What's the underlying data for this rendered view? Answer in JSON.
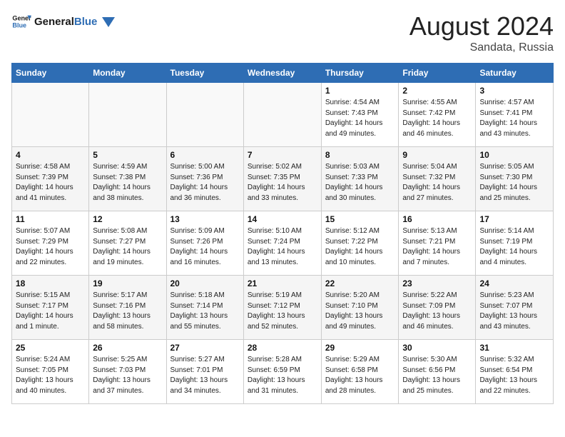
{
  "logo": {
    "line1": "General",
    "line2": "Blue"
  },
  "title": "August 2024",
  "subtitle": "Sandata, Russia",
  "days_header": [
    "Sunday",
    "Monday",
    "Tuesday",
    "Wednesday",
    "Thursday",
    "Friday",
    "Saturday"
  ],
  "weeks": [
    [
      {
        "day": "",
        "info": ""
      },
      {
        "day": "",
        "info": ""
      },
      {
        "day": "",
        "info": ""
      },
      {
        "day": "",
        "info": ""
      },
      {
        "day": "1",
        "info": "Sunrise: 4:54 AM\nSunset: 7:43 PM\nDaylight: 14 hours\nand 49 minutes."
      },
      {
        "day": "2",
        "info": "Sunrise: 4:55 AM\nSunset: 7:42 PM\nDaylight: 14 hours\nand 46 minutes."
      },
      {
        "day": "3",
        "info": "Sunrise: 4:57 AM\nSunset: 7:41 PM\nDaylight: 14 hours\nand 43 minutes."
      }
    ],
    [
      {
        "day": "4",
        "info": "Sunrise: 4:58 AM\nSunset: 7:39 PM\nDaylight: 14 hours\nand 41 minutes."
      },
      {
        "day": "5",
        "info": "Sunrise: 4:59 AM\nSunset: 7:38 PM\nDaylight: 14 hours\nand 38 minutes."
      },
      {
        "day": "6",
        "info": "Sunrise: 5:00 AM\nSunset: 7:36 PM\nDaylight: 14 hours\nand 36 minutes."
      },
      {
        "day": "7",
        "info": "Sunrise: 5:02 AM\nSunset: 7:35 PM\nDaylight: 14 hours\nand 33 minutes."
      },
      {
        "day": "8",
        "info": "Sunrise: 5:03 AM\nSunset: 7:33 PM\nDaylight: 14 hours\nand 30 minutes."
      },
      {
        "day": "9",
        "info": "Sunrise: 5:04 AM\nSunset: 7:32 PM\nDaylight: 14 hours\nand 27 minutes."
      },
      {
        "day": "10",
        "info": "Sunrise: 5:05 AM\nSunset: 7:30 PM\nDaylight: 14 hours\nand 25 minutes."
      }
    ],
    [
      {
        "day": "11",
        "info": "Sunrise: 5:07 AM\nSunset: 7:29 PM\nDaylight: 14 hours\nand 22 minutes."
      },
      {
        "day": "12",
        "info": "Sunrise: 5:08 AM\nSunset: 7:27 PM\nDaylight: 14 hours\nand 19 minutes."
      },
      {
        "day": "13",
        "info": "Sunrise: 5:09 AM\nSunset: 7:26 PM\nDaylight: 14 hours\nand 16 minutes."
      },
      {
        "day": "14",
        "info": "Sunrise: 5:10 AM\nSunset: 7:24 PM\nDaylight: 14 hours\nand 13 minutes."
      },
      {
        "day": "15",
        "info": "Sunrise: 5:12 AM\nSunset: 7:22 PM\nDaylight: 14 hours\nand 10 minutes."
      },
      {
        "day": "16",
        "info": "Sunrise: 5:13 AM\nSunset: 7:21 PM\nDaylight: 14 hours\nand 7 minutes."
      },
      {
        "day": "17",
        "info": "Sunrise: 5:14 AM\nSunset: 7:19 PM\nDaylight: 14 hours\nand 4 minutes."
      }
    ],
    [
      {
        "day": "18",
        "info": "Sunrise: 5:15 AM\nSunset: 7:17 PM\nDaylight: 14 hours\nand 1 minute."
      },
      {
        "day": "19",
        "info": "Sunrise: 5:17 AM\nSunset: 7:16 PM\nDaylight: 13 hours\nand 58 minutes."
      },
      {
        "day": "20",
        "info": "Sunrise: 5:18 AM\nSunset: 7:14 PM\nDaylight: 13 hours\nand 55 minutes."
      },
      {
        "day": "21",
        "info": "Sunrise: 5:19 AM\nSunset: 7:12 PM\nDaylight: 13 hours\nand 52 minutes."
      },
      {
        "day": "22",
        "info": "Sunrise: 5:20 AM\nSunset: 7:10 PM\nDaylight: 13 hours\nand 49 minutes."
      },
      {
        "day": "23",
        "info": "Sunrise: 5:22 AM\nSunset: 7:09 PM\nDaylight: 13 hours\nand 46 minutes."
      },
      {
        "day": "24",
        "info": "Sunrise: 5:23 AM\nSunset: 7:07 PM\nDaylight: 13 hours\nand 43 minutes."
      }
    ],
    [
      {
        "day": "25",
        "info": "Sunrise: 5:24 AM\nSunset: 7:05 PM\nDaylight: 13 hours\nand 40 minutes."
      },
      {
        "day": "26",
        "info": "Sunrise: 5:25 AM\nSunset: 7:03 PM\nDaylight: 13 hours\nand 37 minutes."
      },
      {
        "day": "27",
        "info": "Sunrise: 5:27 AM\nSunset: 7:01 PM\nDaylight: 13 hours\nand 34 minutes."
      },
      {
        "day": "28",
        "info": "Sunrise: 5:28 AM\nSunset: 6:59 PM\nDaylight: 13 hours\nand 31 minutes."
      },
      {
        "day": "29",
        "info": "Sunrise: 5:29 AM\nSunset: 6:58 PM\nDaylight: 13 hours\nand 28 minutes."
      },
      {
        "day": "30",
        "info": "Sunrise: 5:30 AM\nSunset: 6:56 PM\nDaylight: 13 hours\nand 25 minutes."
      },
      {
        "day": "31",
        "info": "Sunrise: 5:32 AM\nSunset: 6:54 PM\nDaylight: 13 hours\nand 22 minutes."
      }
    ]
  ]
}
